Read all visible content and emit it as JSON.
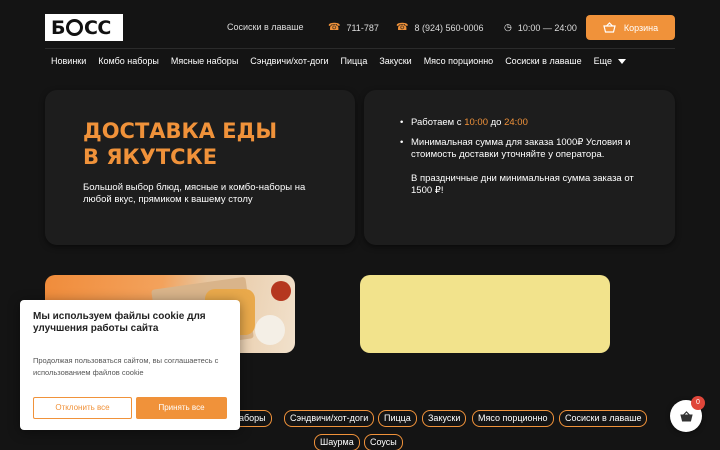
{
  "header": {
    "logo_text": "БОСС",
    "menu_link": "Сосиски в лаваше",
    "phone_1": "711-787",
    "phone_2": "8 (924) 560-0006",
    "hours": "10:00 — 24:00",
    "cart_label": "Корзина",
    "icons": {
      "phone": "phone-icon",
      "clock": "clock-icon",
      "cart": "basket-icon"
    }
  },
  "nav": {
    "items": [
      "Новинки",
      "Комбо наборы",
      "Мясные наборы",
      "Сэндвичи/хот-доги",
      "Пицца",
      "Закуски",
      "Мясо порционно",
      "Сосиски в лаваше"
    ],
    "more_label": "Еще"
  },
  "hero": {
    "title_line1": "ДОСТАВКА ЕДЫ",
    "title_line2": "В ЯКУТСКЕ",
    "subtitle": "Большой выбор блюд, мясные и комбо-наборы на любой вкус, прямиком к вашему столу"
  },
  "info": {
    "hours_prefix": "Работаем с",
    "hours_from": "10:00",
    "hours_mid": "до",
    "hours_to": "24:00",
    "min_order": "Минимальная сумма для заказа 1000₽ Условия и стоимость доставки уточняйте у оператора.",
    "holiday": "В праздничные дни минимальная сумма заказа от 1500 ₽!"
  },
  "categories": {
    "row1": [
      "наборы",
      "Сэндвичи/хот-доги",
      "Пицца",
      "Закуски",
      "Мясо порционно",
      "Сосиски в лаваше"
    ],
    "row2": [
      "Шаурма",
      "Соусы"
    ]
  },
  "cookie": {
    "title": "Мы используем файлы cookie для улучшения работы сайта",
    "text": "Продолжая пользоваться сайтом, вы соглашаетесь с использованием файлов cookie",
    "reject": "Отклонить все",
    "accept": "Принять все"
  },
  "floating_cart": {
    "count": "0"
  },
  "colors": {
    "accent": "#f0923a",
    "background": "#141414",
    "card": "#1d1d1d",
    "banner_yellow": "#f2e38c"
  }
}
